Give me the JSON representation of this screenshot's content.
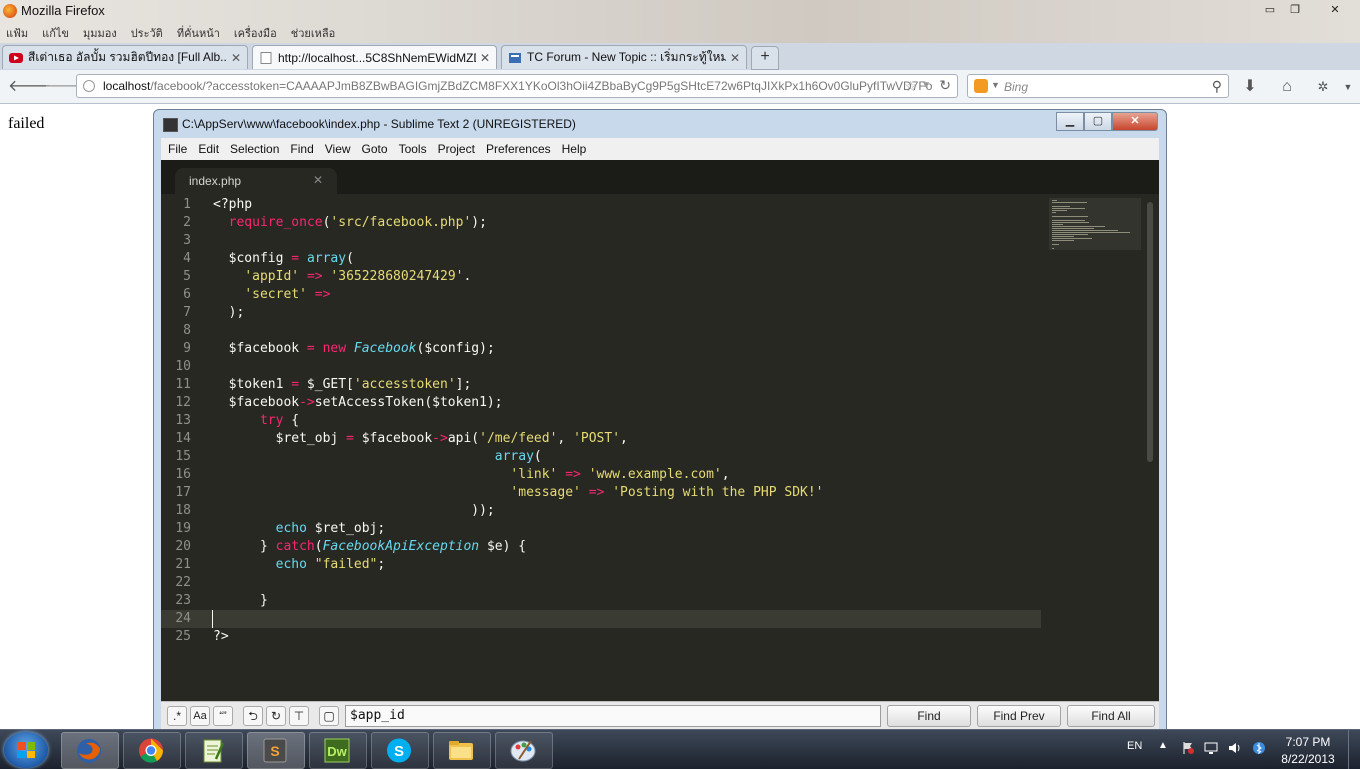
{
  "firefox": {
    "window_title": "Mozilla Firefox",
    "menu": [
      "แฟ้ม",
      "แก้ไข",
      "มุมมอง",
      "ประวัติ",
      "ที่คั่นหน้า",
      "เครื่องมือ",
      "ช่วยเหลือ"
    ],
    "tabs": [
      {
        "label": "สีเต่าเธอ อัลบั้ม รวมฮิตปีทอง [Full Alb...",
        "icon": "youtube-icon"
      },
      {
        "label": "http://localhost...5C8ShNemEWidMZD",
        "icon": "page-icon"
      },
      {
        "label": "TC Forum - New Topic :: เริ่มกระทู้ใหม่",
        "icon": "forum-icon"
      }
    ],
    "url_host": "localhost",
    "url_rest": "/facebook/?accesstoken=CAAAAPJmB8ZBwBAGIGmjZBdZCM8FXX1YKoOl3hOii4ZBbaByCg9P5gSHtcE72w6PtqJIXkPx1h6Ov0GluPyfITwVD7Fo",
    "search_placeholder": "Bing",
    "page_text": "failed"
  },
  "sublime": {
    "title": "C:\\AppServ\\www\\facebook\\index.php - Sublime Text 2 (UNREGISTERED)",
    "menu": [
      "File",
      "Edit",
      "Selection",
      "Find",
      "View",
      "Goto",
      "Tools",
      "Project",
      "Preferences",
      "Help"
    ],
    "tab": "index.php",
    "find_value": "$app_id",
    "find_buttons": [
      "Find",
      "Find Prev",
      "Find All"
    ],
    "find_options": [
      ".*",
      "Aa",
      "“”"
    ],
    "current_line": 24,
    "code": [
      {
        "n": "1",
        "t": [
          [
            "p",
            "<?php"
          ]
        ]
      },
      {
        "n": "2",
        "t": [
          [
            "p",
            "  "
          ],
          [
            "k",
            "require_once"
          ],
          [
            "p",
            "("
          ],
          [
            "s",
            "'src/facebook.php'"
          ],
          [
            "p",
            ");"
          ]
        ]
      },
      {
        "n": "3",
        "t": []
      },
      {
        "n": "4",
        "t": [
          [
            "p",
            "  $config "
          ],
          [
            "k",
            "="
          ],
          [
            "p",
            " "
          ],
          [
            "f",
            "array"
          ],
          [
            "p",
            "("
          ]
        ]
      },
      {
        "n": "5",
        "t": [
          [
            "p",
            "    "
          ],
          [
            "s",
            "'appId'"
          ],
          [
            "p",
            " "
          ],
          [
            "k",
            "=>"
          ],
          [
            "p",
            " "
          ],
          [
            "s",
            "'365228680247429'"
          ],
          [
            "p",
            "."
          ]
        ]
      },
      {
        "n": "6",
        "t": [
          [
            "p",
            "    "
          ],
          [
            "s",
            "'secret'"
          ],
          [
            "p",
            " "
          ],
          [
            "k",
            "=>"
          ]
        ]
      },
      {
        "n": "7",
        "t": [
          [
            "p",
            "  );"
          ]
        ]
      },
      {
        "n": "8",
        "t": []
      },
      {
        "n": "9",
        "t": [
          [
            "p",
            "  $facebook "
          ],
          [
            "k",
            "="
          ],
          [
            "p",
            " "
          ],
          [
            "k",
            "new"
          ],
          [
            "p",
            " "
          ],
          [
            "c",
            "Facebook"
          ],
          [
            "p",
            "($config);"
          ]
        ]
      },
      {
        "n": "10",
        "t": []
      },
      {
        "n": "11",
        "t": [
          [
            "p",
            "  $token1 "
          ],
          [
            "k",
            "="
          ],
          [
            "p",
            " $_GET["
          ],
          [
            "s",
            "'accesstoken'"
          ],
          [
            "p",
            "];"
          ]
        ]
      },
      {
        "n": "12",
        "t": [
          [
            "p",
            "  $facebook"
          ],
          [
            "k",
            "->"
          ],
          [
            "p",
            "setAccessToken($token1);"
          ]
        ]
      },
      {
        "n": "13",
        "t": [
          [
            "p",
            "      "
          ],
          [
            "k",
            "try"
          ],
          [
            "p",
            " {"
          ]
        ]
      },
      {
        "n": "14",
        "t": [
          [
            "p",
            "        $ret_obj "
          ],
          [
            "k",
            "="
          ],
          [
            "p",
            " $facebook"
          ],
          [
            "k",
            "->"
          ],
          [
            "p",
            "api("
          ],
          [
            "s",
            "'/me/feed'"
          ],
          [
            "p",
            ", "
          ],
          [
            "s",
            "'POST'"
          ],
          [
            "p",
            ","
          ]
        ]
      },
      {
        "n": "15",
        "t": [
          [
            "p",
            "                                    "
          ],
          [
            "f",
            "array"
          ],
          [
            "p",
            "("
          ]
        ]
      },
      {
        "n": "16",
        "t": [
          [
            "p",
            "                                      "
          ],
          [
            "s",
            "'link'"
          ],
          [
            "p",
            " "
          ],
          [
            "k",
            "=>"
          ],
          [
            "p",
            " "
          ],
          [
            "s",
            "'www.example.com'"
          ],
          [
            "p",
            ","
          ]
        ]
      },
      {
        "n": "17",
        "t": [
          [
            "p",
            "                                      "
          ],
          [
            "s",
            "'message'"
          ],
          [
            "p",
            " "
          ],
          [
            "k",
            "=>"
          ],
          [
            "p",
            " "
          ],
          [
            "s",
            "'Posting with the PHP SDK!'"
          ]
        ]
      },
      {
        "n": "18",
        "t": [
          [
            "p",
            "                                 ));"
          ]
        ]
      },
      {
        "n": "19",
        "t": [
          [
            "p",
            "        "
          ],
          [
            "f",
            "echo"
          ],
          [
            "p",
            " $ret_obj;"
          ]
        ]
      },
      {
        "n": "20",
        "t": [
          [
            "p",
            "      } "
          ],
          [
            "k",
            "catch"
          ],
          [
            "p",
            "("
          ],
          [
            "c",
            "FacebookApiException"
          ],
          [
            "p",
            " $e) {"
          ]
        ]
      },
      {
        "n": "21",
        "t": [
          [
            "p",
            "        "
          ],
          [
            "f",
            "echo"
          ],
          [
            "p",
            " "
          ],
          [
            "s",
            "\"failed\""
          ],
          [
            "p",
            ";"
          ]
        ]
      },
      {
        "n": "22",
        "t": []
      },
      {
        "n": "23",
        "t": [
          [
            "p",
            "      }"
          ]
        ]
      },
      {
        "n": "24",
        "t": []
      },
      {
        "n": "25",
        "t": [
          [
            "p",
            "?>"
          ]
        ]
      }
    ]
  },
  "taskbar": {
    "apps": [
      "firefox-icon",
      "chrome-icon",
      "notepad-icon",
      "sublime-icon",
      "dreamweaver-icon",
      "skype-icon",
      "explorer-folder-icon",
      "paint-icon"
    ],
    "dw_label": "Dw",
    "lang": "EN",
    "time": "7:07 PM",
    "date": "8/22/2013"
  }
}
